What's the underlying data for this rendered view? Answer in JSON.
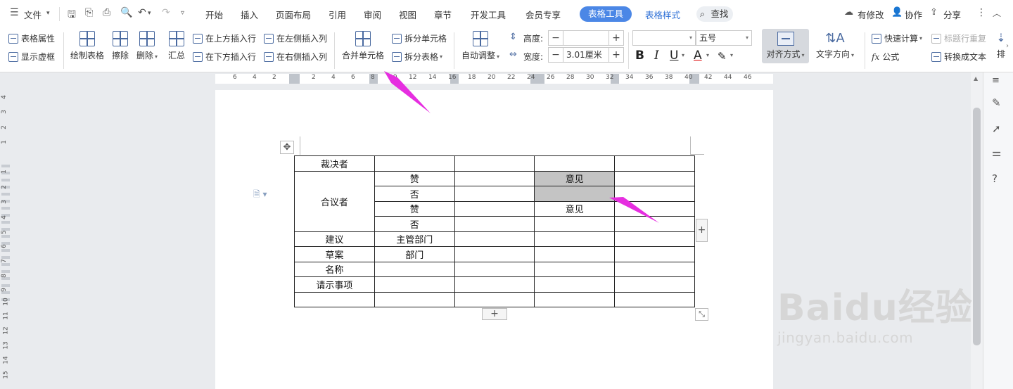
{
  "menu": {
    "file": "文件",
    "tabs": [
      "开始",
      "插入",
      "页面布局",
      "引用",
      "审阅",
      "视图",
      "章节",
      "开发工具",
      "会员专享"
    ],
    "context_tabs": {
      "table_tools": "表格工具",
      "table_style": "表格样式"
    },
    "search": "查找",
    "right": {
      "modified": "有修改",
      "collab": "协作",
      "share": "分享"
    }
  },
  "ribbon": {
    "table_props": "表格属性",
    "show_grid": "显示虚框",
    "draw_table": "绘制表格",
    "erase": "擦除",
    "delete": "删除",
    "summary": "汇总",
    "insert_row_above": "在上方插入行",
    "insert_row_below": "在下方插入行",
    "insert_col_left": "在左侧插入列",
    "insert_col_right": "在右侧插入列",
    "merge_cells": "合并单元格",
    "split_cells": "拆分单元格",
    "split_table": "拆分表格",
    "auto_fit": "自动调整",
    "height_label": "高度:",
    "height_value": "",
    "width_label": "宽度:",
    "width_value": "3.01厘米",
    "font_name": "",
    "font_size": "五号",
    "align": "对齐方式",
    "text_direction": "文字方向",
    "quick_calc": "快速计算",
    "repeat_header": "标题行重复",
    "formula": "公式",
    "convert_text": "转换成文本",
    "sort_partial": "排"
  },
  "ruler": {
    "top_numbers": [
      "6",
      "4",
      "2",
      "2",
      "4",
      "6",
      "8",
      "10",
      "12",
      "14",
      "16",
      "18",
      "20",
      "22",
      "24",
      "26",
      "28",
      "30",
      "32",
      "34",
      "36",
      "38",
      "40",
      "42",
      "44",
      "46"
    ],
    "left_numbers": [
      "4",
      "3",
      "2",
      "1",
      "1",
      "2",
      "3",
      "4",
      "5",
      "6",
      "7",
      "8",
      "9",
      "10",
      "11",
      "12",
      "13",
      "14",
      "15"
    ]
  },
  "table": {
    "rows": [
      [
        "裁决者",
        "",
        "",
        "",
        ""
      ],
      [
        "合议者",
        "赞",
        "",
        "意见",
        ""
      ],
      [
        "",
        "否",
        "",
        "",
        ""
      ],
      [
        "",
        "赞",
        "",
        "意见",
        ""
      ],
      [
        "",
        "否",
        "",
        "",
        ""
      ],
      [
        "建议",
        "主管部门",
        "",
        "",
        ""
      ],
      [
        "草案",
        "部门",
        "",
        "",
        ""
      ],
      [
        "名称",
        "",
        "",
        "",
        ""
      ],
      [
        "请示事项",
        "",
        "",
        "",
        ""
      ],
      [
        "",
        "",
        "",
        "",
        ""
      ]
    ]
  },
  "watermark": {
    "brand": "Baidu经验",
    "url": "jingyan.baidu.com"
  },
  "colors": {
    "accent": "#4b87e6",
    "annotation": "#e62ee0",
    "selection": "#c4c4c4"
  }
}
